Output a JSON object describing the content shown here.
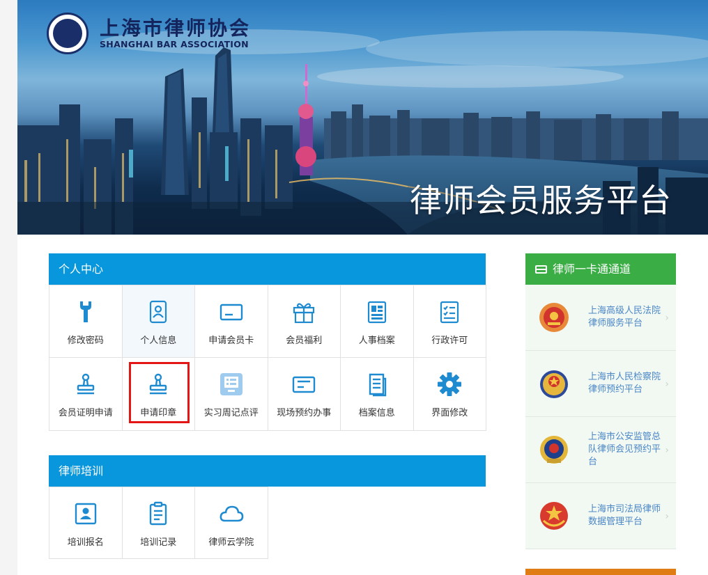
{
  "header": {
    "org_name_cn": "上海市律师协会",
    "org_name_en": "SHANGHAI BAR ASSOCIATION",
    "platform_title": "律师会员服务平台"
  },
  "personal_center": {
    "title": "个人中心",
    "items": [
      {
        "label": "修改密码",
        "icon": "wrench-icon"
      },
      {
        "label": "个人信息",
        "icon": "profile-card-icon"
      },
      {
        "label": "申请会员卡",
        "icon": "member-card-icon"
      },
      {
        "label": "会员福利",
        "icon": "gift-icon"
      },
      {
        "label": "人事档案",
        "icon": "personnel-file-icon"
      },
      {
        "label": "行政许可",
        "icon": "checklist-icon"
      },
      {
        "label": "会员证明申请",
        "icon": "stamp-icon"
      },
      {
        "label": "申请印章",
        "icon": "stamp-icon"
      },
      {
        "label": "实习周记点评",
        "icon": "weekly-review-icon"
      },
      {
        "label": "现场预约办事",
        "icon": "appointment-card-icon"
      },
      {
        "label": "档案信息",
        "icon": "archive-doc-icon"
      },
      {
        "label": "界面修改",
        "icon": "gear-icon"
      }
    ]
  },
  "training": {
    "title": "律师培训",
    "items": [
      {
        "label": "培训报名",
        "icon": "registration-badge-icon"
      },
      {
        "label": "培训记录",
        "icon": "clipboard-icon"
      },
      {
        "label": "律师云学院",
        "icon": "cloud-icon"
      }
    ]
  },
  "one_card": {
    "title": "律师一卡通通道",
    "items": [
      {
        "line1": "上海高级人民法院",
        "line2": "律师服务平台",
        "icon": "court-emblem-icon"
      },
      {
        "line1": "上海市人民检察院",
        "line2": "律师预约平台",
        "icon": "procuratorate-emblem-icon"
      },
      {
        "line1": "上海市公安监管总",
        "line2": "队律师会见预约平台",
        "icon": "police-emblem-icon"
      },
      {
        "line1": "上海市司法局律师",
        "line2": "数据管理平台",
        "icon": "justice-emblem-icon"
      }
    ]
  },
  "colors": {
    "panel_header": "#0896dc",
    "side_header": "#3aae45",
    "icon_blue": "#1e8ad0",
    "highlight": "#e41515",
    "side_link": "#4a86c7"
  }
}
